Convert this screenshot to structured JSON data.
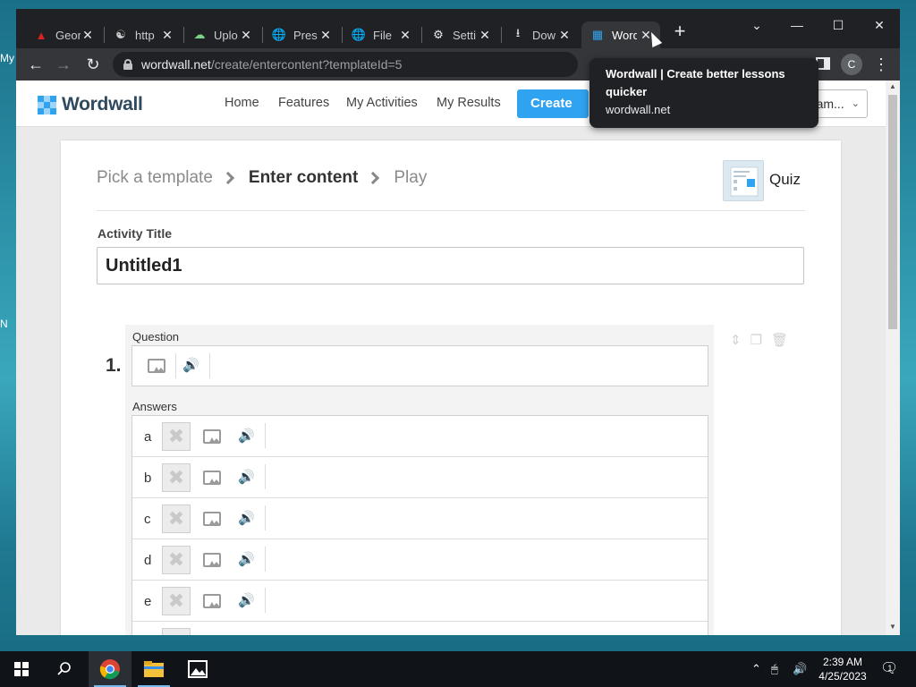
{
  "desktop": {
    "peek_top": "My",
    "peek_mid": "N"
  },
  "browser": {
    "tabs": [
      {
        "label": "Geor",
        "icon": "adobe-icon",
        "icon_color": "#e02020"
      },
      {
        "label": "http",
        "icon": "stamp-icon",
        "icon_color": "#cccccc"
      },
      {
        "label": "Uplo",
        "icon": "cloud-upload-icon",
        "icon_color": "#7bd389"
      },
      {
        "label": "Pres",
        "icon": "globe-icon",
        "icon_color": "#bdc1c6"
      },
      {
        "label": "File",
        "icon": "globe-icon",
        "icon_color": "#bdc1c6"
      },
      {
        "label": "Setti",
        "icon": "gear-icon",
        "icon_color": "#e8eaed"
      },
      {
        "label": "Dow",
        "icon": "download-icon",
        "icon_color": "#e8eaed"
      },
      {
        "label": "Word",
        "icon": "wordwall-favicon",
        "icon_color": "#2fa3f0",
        "active": true
      }
    ],
    "url_host": "wordwall.net",
    "url_path": "/create/entercontent?templateId=5",
    "profile_initial": "C",
    "tooltip": {
      "title": "Wordwall | Create better lessons quicker",
      "url": "wordwall.net"
    }
  },
  "site": {
    "logo_text": "Wordwall",
    "logo_colors": [
      "#2fa3f0",
      "#ffffff",
      "#2fa3f0",
      "#ffffff",
      "#2fa3f0",
      "#ffffff",
      "#2fa3f0",
      "#ffffff",
      "#2fa3f0"
    ],
    "nav": [
      "Home",
      "Features",
      "My Activities",
      "My Results"
    ],
    "create_label": "Create",
    "language_label": "ngam..."
  },
  "editor": {
    "crumbs": [
      "Pick a template",
      "Enter content",
      "Play"
    ],
    "active_crumb": 1,
    "template_name": "Quiz",
    "activity_title_label": "Activity Title",
    "activity_title_value": "Untitled1",
    "question_number": "1.",
    "question_label": "Question",
    "answers_label": "Answers",
    "answers": [
      "a",
      "b",
      "c",
      "d",
      "e"
    ]
  },
  "taskbar": {
    "time": "2:39 AM",
    "date": "4/25/2023",
    "notification_count": "1"
  }
}
